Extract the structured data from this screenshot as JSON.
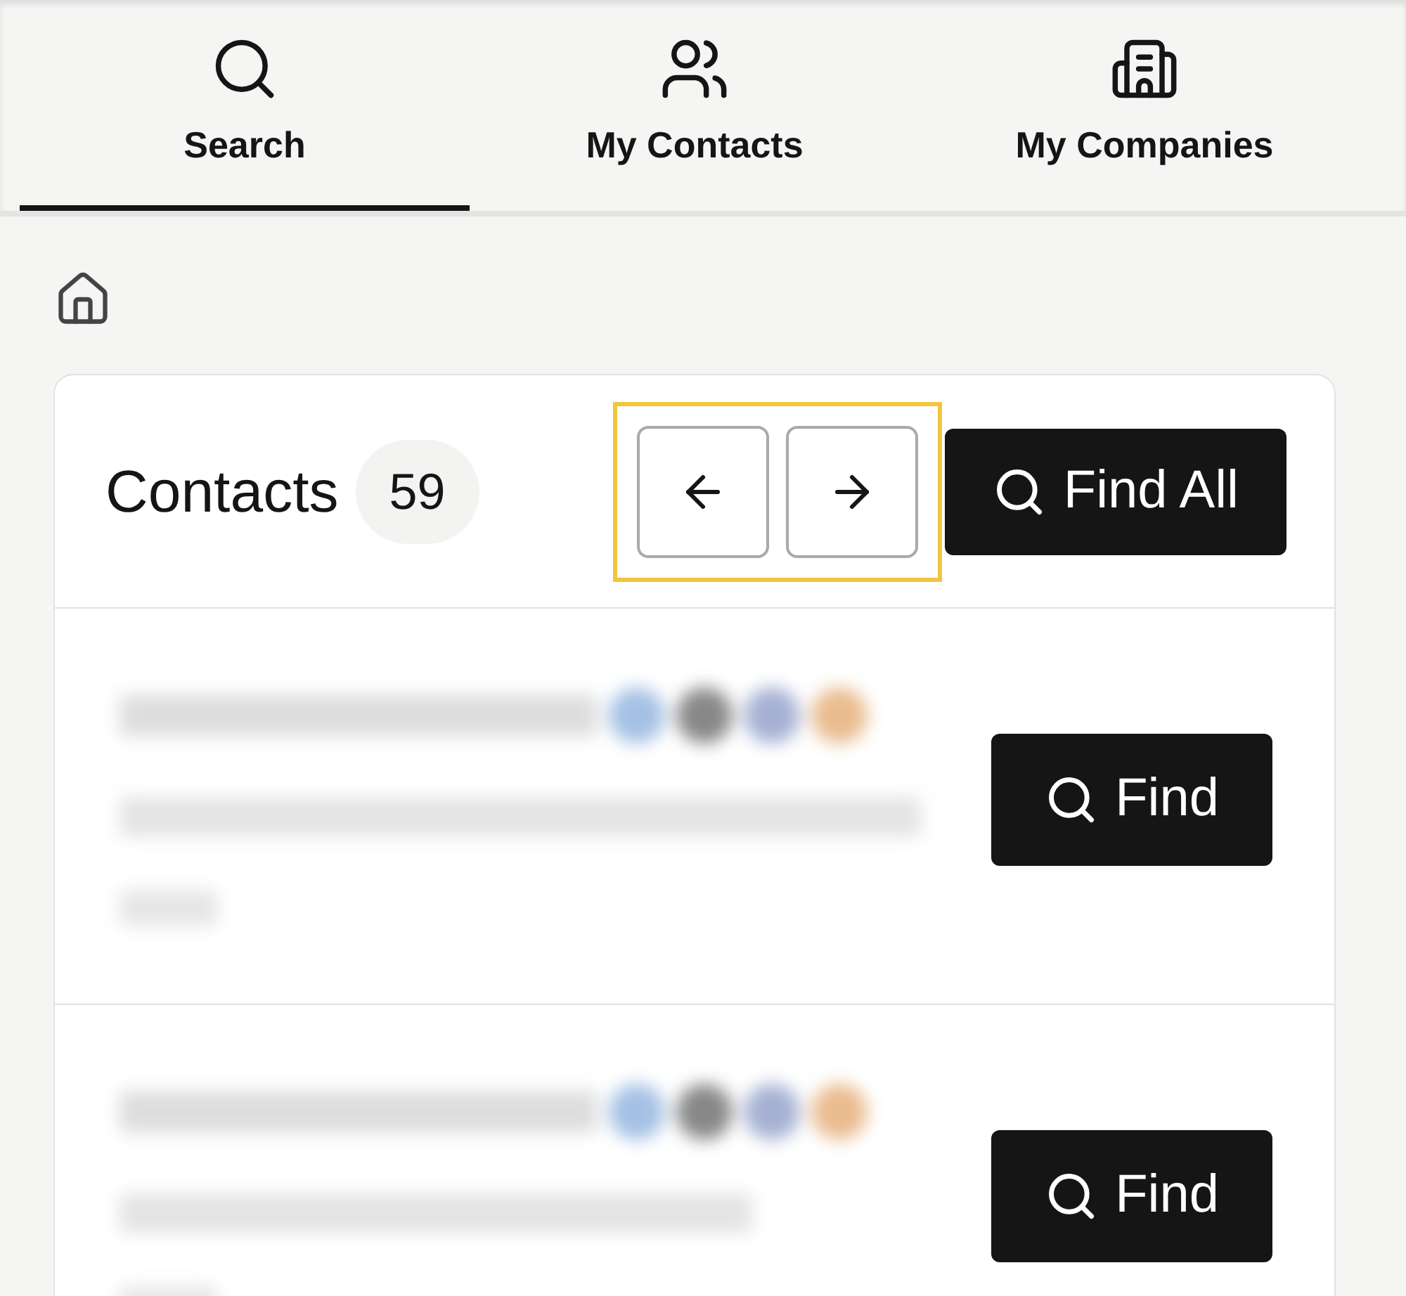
{
  "tabs": [
    {
      "label": "Search",
      "selected": true
    },
    {
      "label": "My Contacts",
      "selected": false
    },
    {
      "label": "My Companies",
      "selected": false
    }
  ],
  "card": {
    "title": "Contacts",
    "count": "59",
    "prev_highlighted": true,
    "find_all": "Find All",
    "rows": [
      {
        "find": "Find"
      },
      {
        "find": "Find"
      }
    ]
  }
}
